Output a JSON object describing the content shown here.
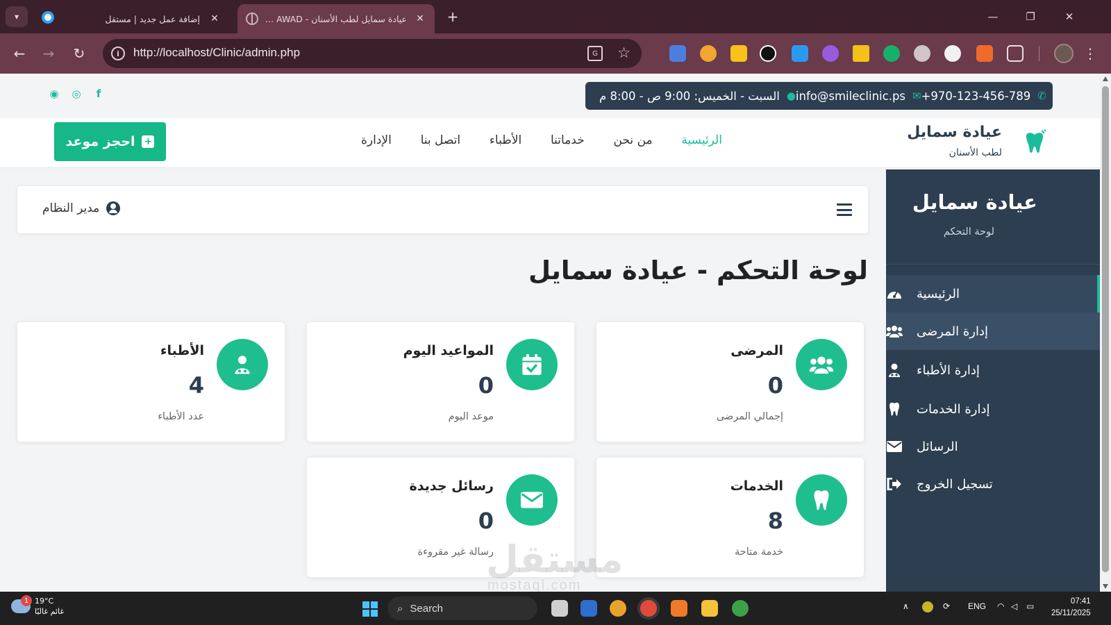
{
  "browser": {
    "tabs": [
      {
        "title": "إضافة عمل جديد | مستقل"
      },
      {
        "title": "عيادة سمايل لطب الأسنان - ADA AWAD"
      }
    ],
    "url": "http://localhost/Clinic/admin.php"
  },
  "topbar": {
    "phone": "+970-123-456-789",
    "email": "info@smileclinic.ps",
    "hours": "السبت - الخميس: 9:00 ص - 8:00 م"
  },
  "nav": {
    "brand_title": "عيادة سمايل",
    "brand_subtitle": "لطب الأسنان",
    "items": [
      "الرئيسية",
      "من نحن",
      "خدماتنا",
      "الأطباء",
      "اتصل بنا",
      "الإدارة"
    ],
    "book_button": "احجز موعد"
  },
  "sidebar": {
    "title": "عيادة سمايل",
    "subtitle": "لوحة التحكم",
    "items": [
      {
        "label": "الرئيسية",
        "icon": "dashboard-icon"
      },
      {
        "label": "إدارة المرضى",
        "icon": "users-icon"
      },
      {
        "label": "إدارة الأطباء",
        "icon": "doctor-icon"
      },
      {
        "label": "إدارة الخدمات",
        "icon": "tooth-icon"
      },
      {
        "label": "الرسائل",
        "icon": "envelope-icon"
      },
      {
        "label": "تسجيل الخروج",
        "icon": "logout-icon"
      }
    ]
  },
  "header": {
    "user": "مدير النظام"
  },
  "page_title": "لوحة التحكم - عيادة سمايل",
  "stats": [
    {
      "title": "المرضى",
      "value": "0",
      "sub": "إجمالي المرضى",
      "icon": "users-icon"
    },
    {
      "title": "المواعيد اليوم",
      "value": "0",
      "sub": "موعد اليوم",
      "icon": "calendar-check-icon"
    },
    {
      "title": "الأطباء",
      "value": "4",
      "sub": "عدد الأطباء",
      "icon": "doctor-icon"
    },
    {
      "title": "الخدمات",
      "value": "8",
      "sub": "خدمة متاحة",
      "icon": "tooth-icon"
    },
    {
      "title": "رسائل جديدة",
      "value": "0",
      "sub": "رسالة غير مقروءة",
      "icon": "envelope-icon"
    }
  ],
  "watermark": {
    "text": "مستقل",
    "sub": "mostaql.com"
  },
  "taskbar": {
    "weather_temp": "19°C",
    "weather_desc": "غائم غالبًا",
    "weather_badge": "1",
    "search": "Search",
    "lang": "ENG",
    "time": "07:41",
    "date": "25/11/2025"
  },
  "colors": {
    "accent": "#1abc9c",
    "sidebar": "#2c3e50",
    "browser_frame": "#6b3a4b"
  }
}
